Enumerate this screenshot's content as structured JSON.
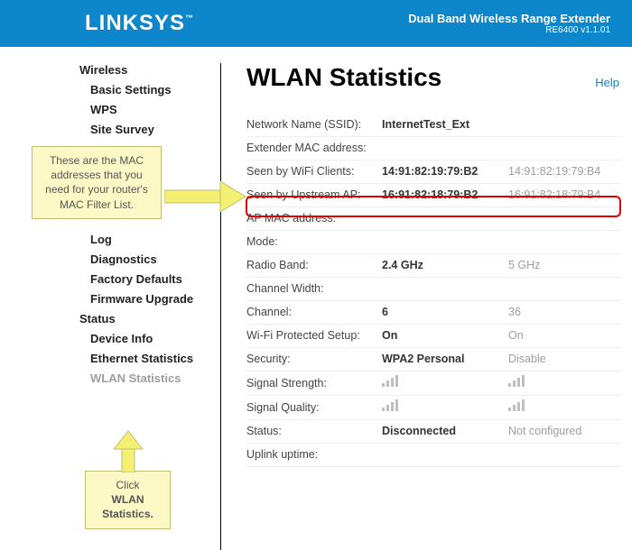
{
  "header": {
    "logo": "LINKSYS",
    "logo_tm": "™",
    "title": "Dual Band Wireless Range Extender",
    "model": "RE6400 v1.1.01"
  },
  "sidebar": {
    "groups": [
      {
        "label": "Wireless",
        "items": [
          "Basic Settings",
          "WPS",
          "Site Survey"
        ]
      },
      {
        "label_hidden": true,
        "items": [
          "Log",
          "Diagnostics",
          "Factory Defaults",
          "Firmware Upgrade"
        ]
      },
      {
        "label": "Status",
        "items": [
          "Device Info",
          "Ethernet Statistics"
        ],
        "disabled_items": [
          "WLAN Statistics"
        ]
      }
    ]
  },
  "main": {
    "title": "WLAN Statistics",
    "help": "Help",
    "rows": [
      {
        "label": "Network Name (SSID):",
        "v1": "InternetTest_Ext",
        "v2": ""
      },
      {
        "label": "Extender MAC address:",
        "v1": "",
        "v2": ""
      },
      {
        "label": "Seen by WiFi Clients:",
        "v1": "14:91:82:19:79:B2",
        "v2": "14:91:82:19:79:B4"
      },
      {
        "label": "Seen by Upstream AP:",
        "v1": "16:91:82:18:79:B2",
        "v2": "16:91:82:18:79:B4"
      },
      {
        "label": "AP MAC address:",
        "v1": "",
        "v2": ""
      },
      {
        "label": "Mode:",
        "v1": "",
        "v2": ""
      },
      {
        "label": "Radio Band:",
        "v1": "2.4 GHz",
        "v2": "5 GHz"
      },
      {
        "label": "Channel Width:",
        "v1": "",
        "v2": ""
      },
      {
        "label": "Channel:",
        "v1": "6",
        "v2": "36"
      },
      {
        "label": "Wi-Fi Protected Setup:",
        "v1": "On",
        "v2": "On"
      },
      {
        "label": "Security:",
        "v1": "WPA2 Personal",
        "v2": "Disable"
      },
      {
        "label": "Signal Strength:",
        "v1": "__SIG__",
        "v2": "__SIG__"
      },
      {
        "label": "Signal Quality:",
        "v1": "__SIG__",
        "v2": "__SIG__"
      },
      {
        "label": "Status:",
        "v1": "Disconnected",
        "v2": "Not configured"
      },
      {
        "label": "Uplink uptime:",
        "v1": "",
        "v2": ""
      }
    ]
  },
  "callouts": {
    "top": "These are the MAC addresses that you need for your router's MAC Filter List.",
    "bottom_line1": "Click",
    "bottom_line2": "WLAN Statistics."
  }
}
